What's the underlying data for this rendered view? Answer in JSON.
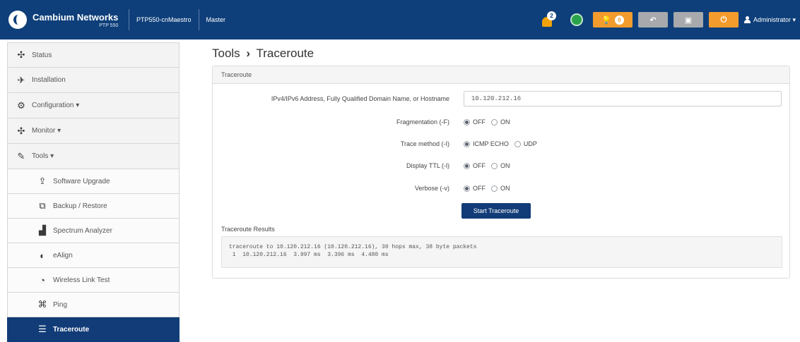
{
  "header": {
    "brand_name": "Cambium Networks",
    "brand_model": "PTP 550",
    "device_name": "PTP550-cnMaestro",
    "role": "Master",
    "alarm_count": "2",
    "alerts_count": "0",
    "user": "Administrator",
    "colors": {
      "bar": "#0e3f7a",
      "orange": "#f39c2d",
      "gray": "#a7a9ac"
    }
  },
  "sidebar": {
    "items": [
      {
        "label": "Status",
        "icon": "status-icon"
      },
      {
        "label": "Installation",
        "icon": "installation-icon"
      },
      {
        "label": "Configuration",
        "icon": "gear-icon"
      },
      {
        "label": "Monitor",
        "icon": "monitor-icon"
      },
      {
        "label": "Tools",
        "icon": "wrench-icon"
      },
      {
        "label": "Software Upgrade",
        "icon": "upgrade-icon"
      },
      {
        "label": "Backup / Restore",
        "icon": "backup-icon"
      },
      {
        "label": "Spectrum Analyzer",
        "icon": "spectrum-icon"
      },
      {
        "label": "eAlign",
        "icon": "ealign-icon"
      },
      {
        "label": "Wireless Link Test",
        "icon": "link-test-icon"
      },
      {
        "label": "Ping",
        "icon": "ping-icon"
      },
      {
        "label": "Traceroute",
        "icon": "traceroute-icon"
      }
    ],
    "active": "Traceroute"
  },
  "breadcrumb": {
    "parent": "Tools",
    "separator": "›",
    "current": "Traceroute"
  },
  "panel": {
    "title": "Traceroute",
    "address_label": "IPv4/IPv6 Address, Fully Qualified Domain Name, or Hostname",
    "address_value": "10.120.212.16",
    "fragmentation_label": "Fragmentation (-F)",
    "trace_method_label": "Trace method (-I)",
    "display_ttl_label": "Display TTL (-l)",
    "verbose_label": "Verbose (-v)",
    "opt_off": "OFF",
    "opt_on": "ON",
    "opt_icmp": "ICMP ECHO",
    "opt_udp": "UDP",
    "start_button": "Start Traceroute",
    "results_label": "Traceroute Results",
    "results_line1": "traceroute to 10.120.212.16 (10.120.212.16), 30 hops max, 38 byte packets",
    "results_line2": " 1  10.120.212.16  3.997 ms  3.396 ms  4.480 ms"
  }
}
